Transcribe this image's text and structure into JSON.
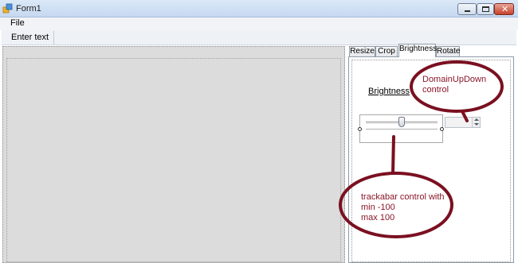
{
  "window": {
    "title": "Form1"
  },
  "menu": {
    "file_label": "File"
  },
  "toolbar": {
    "enter_text_label": "Enter text"
  },
  "tabs": [
    {
      "label": "Resize",
      "active": false
    },
    {
      "label": "Crop",
      "active": false
    },
    {
      "label": "Brightness",
      "active": true
    },
    {
      "label": "Rotate",
      "active": false
    }
  ],
  "brightness_tab": {
    "label": "Brightness",
    "trackbar_value": 0,
    "updown_value": ""
  },
  "annotations": {
    "domain_updown_line1": "DomainUpDown",
    "domain_updown_line2": "control",
    "trackbar_line1": "trackabar control with",
    "trackbar_line2": "min -100",
    "trackbar_line3": "max 100",
    "color": "#7a1020"
  }
}
